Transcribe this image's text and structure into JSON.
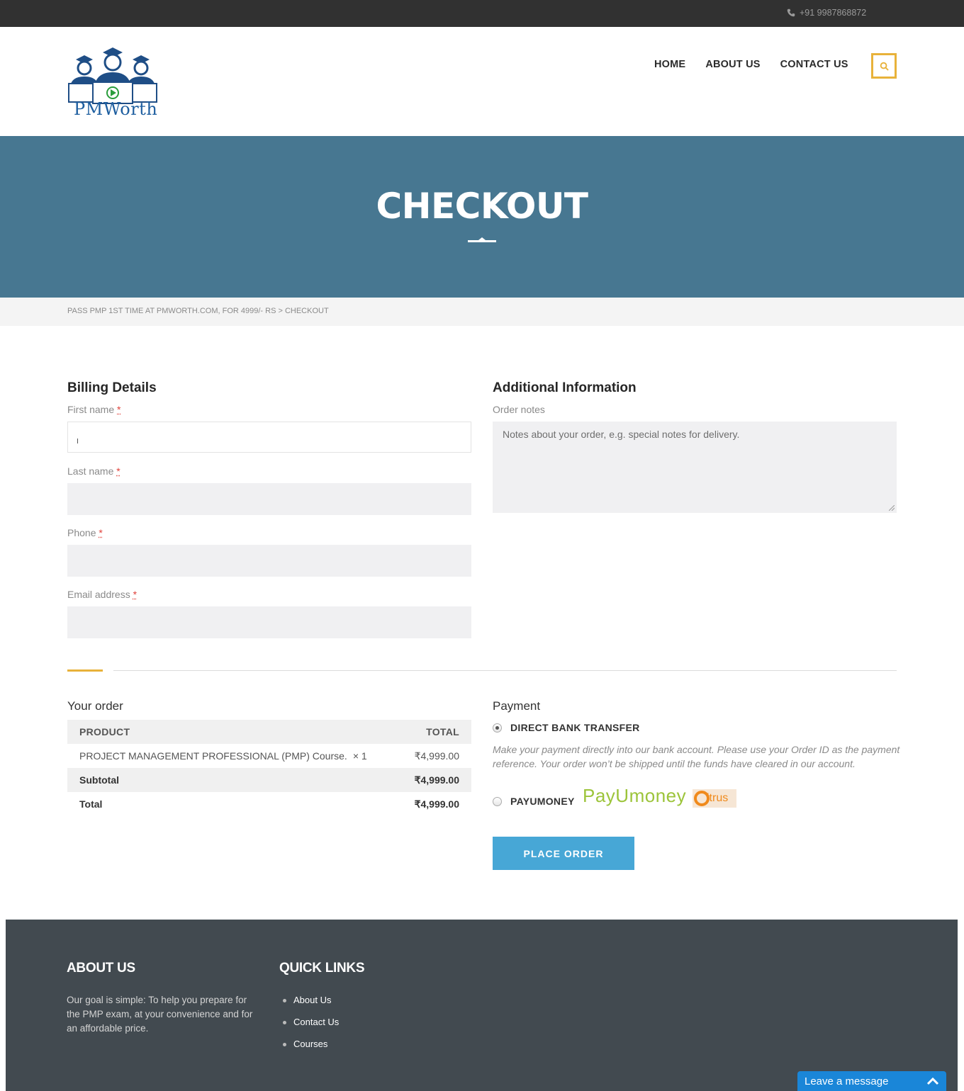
{
  "topbar": {
    "phone": "+91 9987868872"
  },
  "header": {
    "logo_text": "PMWorth",
    "nav": [
      "HOME",
      "ABOUT US",
      "CONTACT US"
    ]
  },
  "hero": {
    "title": "CHECKOUT"
  },
  "breadcrumb": "PASS PMP 1ST TIME AT PMWORTH.COM, FOR 4999/- RS > CHECKOUT",
  "billing": {
    "title": "Billing Details",
    "required_mark": "*",
    "fields": [
      {
        "label": "First name",
        "value": ""
      },
      {
        "label": "Last name",
        "value": ""
      },
      {
        "label": "Phone",
        "value": ""
      },
      {
        "label": "Email address",
        "value": ""
      }
    ]
  },
  "additional": {
    "title": "Additional Information",
    "notes_label": "Order notes",
    "notes_placeholder": "Notes about your order, e.g. special notes for delivery."
  },
  "order": {
    "title": "Your order",
    "col_product": "PRODUCT",
    "col_total": "TOTAL",
    "item_name": "PROJECT MANAGEMENT PROFESSIONAL (PMP) Course.",
    "item_qty": "× 1",
    "item_total": "₹4,999.00",
    "subtotal_label": "Subtotal",
    "subtotal_value": "₹4,999.00",
    "total_label": "Total",
    "total_value": "₹4,999.00"
  },
  "payment": {
    "title": "Payment",
    "option1": "DIRECT BANK TRANSFER",
    "option1_selected": true,
    "option1_desc": "Make your payment directly into our bank account. Please use your Order ID as the payment reference. Your order won’t be shipped until the funds have cleared in our account.",
    "option2": "PAYUMONEY",
    "payu_logo": "PayUmoney",
    "citrus_logo": "itrus",
    "place_order": "PLACE ORDER"
  },
  "footer": {
    "about_title": "ABOUT US",
    "about_text": "Our goal is simple: To help you prepare for the PMP exam, at your convenience and for an affordable price.",
    "links_title": "QUICK LINKS",
    "links": [
      "About Us",
      "Contact Us",
      "Courses"
    ]
  },
  "chat": {
    "label": "Leave a message"
  },
  "colors": {
    "accent": "#e8b23a",
    "hero": "#477791",
    "button": "#47a7d6",
    "footer": "#424a50",
    "chat": "#1a86d8"
  }
}
